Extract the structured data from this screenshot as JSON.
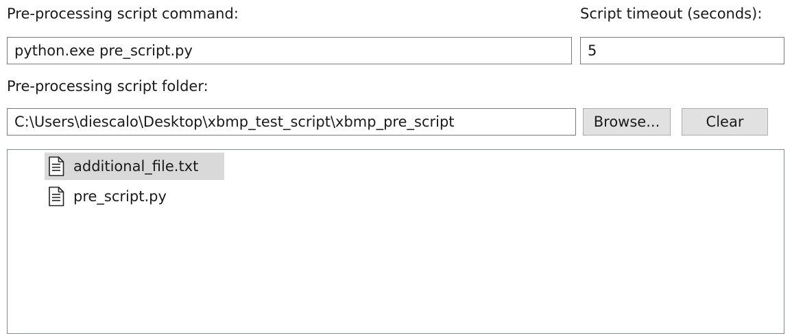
{
  "command": {
    "label": "Pre-processing script command:",
    "value": "python.exe pre_script.py"
  },
  "timeout": {
    "label": "Script timeout (seconds):",
    "value": "5"
  },
  "folder": {
    "label": "Pre-processing script folder:",
    "value": "C:\\Users\\diescalo\\Desktop\\xbmp_test_script\\xbmp_pre_script",
    "browse_label": "Browse...",
    "clear_label": "Clear"
  },
  "files": [
    {
      "name": "additional_file.txt",
      "icon": "text-file-icon",
      "selected": true
    },
    {
      "name": "pre_script.py",
      "icon": "text-file-icon",
      "selected": false
    }
  ]
}
